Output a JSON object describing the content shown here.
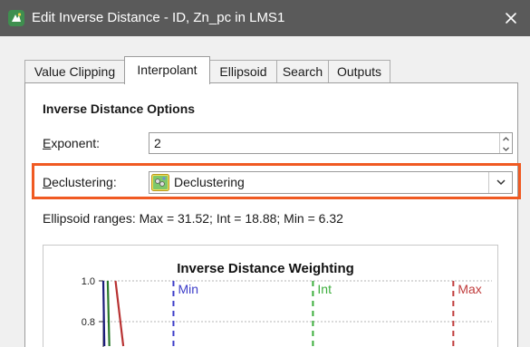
{
  "window": {
    "title": "Edit Inverse Distance - ID, Zn_pc in LMS1"
  },
  "tabs": [
    {
      "label": "Value Clipping",
      "active": false
    },
    {
      "label": "Interpolant",
      "active": true
    },
    {
      "label": "Ellipsoid",
      "active": false
    },
    {
      "label": "Search",
      "active": false
    },
    {
      "label": "Outputs",
      "active": false
    }
  ],
  "options": {
    "section_title": "Inverse Distance Options",
    "exponent": {
      "label_first": "E",
      "label_rest": "xponent:",
      "value": "2"
    },
    "declustering": {
      "label_first": "D",
      "label_rest": "eclustering:",
      "value": "Declustering",
      "icon": "declustering-object-icon"
    },
    "ellipsoid_ranges": "Ellipsoid ranges:  Max = 31.52; Int = 18.88; Min = 6.32"
  },
  "chart_data": {
    "type": "line",
    "title": "Inverse Distance Weighting",
    "y_tick_labels": [
      "1.0",
      "0.8"
    ],
    "ylim": [
      0.68,
      1.0
    ],
    "xlim": [
      0,
      35
    ],
    "grid": true,
    "markers": [
      {
        "label": "Min",
        "x": 6.32,
        "color": "#3c3cc8"
      },
      {
        "label": "Int",
        "x": 18.88,
        "color": "#3cae3c"
      },
      {
        "label": "Max",
        "x": 31.52,
        "color": "#c03c3c"
      }
    ],
    "curves": [
      {
        "color": "#1c1c7a",
        "points": [
          [
            0.0,
            1.0
          ],
          [
            0.1,
            0.68
          ]
        ]
      },
      {
        "color": "#2a7a2a",
        "points": [
          [
            0.4,
            1.0
          ],
          [
            0.55,
            0.68
          ]
        ]
      },
      {
        "color": "#b83232",
        "points": [
          [
            1.1,
            1.0
          ],
          [
            1.8,
            0.68
          ]
        ]
      }
    ]
  },
  "colors": {
    "titlebar": "#5a5a5a",
    "highlight": "#f05a22",
    "min_marker": "#3c3cc8",
    "int_marker": "#3cae3c",
    "max_marker": "#c03c3c"
  }
}
